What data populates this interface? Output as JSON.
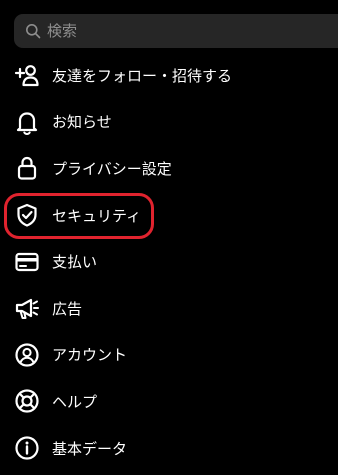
{
  "search": {
    "placeholder": "検索",
    "icon": "search-icon"
  },
  "menu": {
    "items": [
      {
        "icon": "add-user-icon",
        "label": "友達をフォロー・招待する"
      },
      {
        "icon": "bell-icon",
        "label": "お知らせ"
      },
      {
        "icon": "lock-icon",
        "label": "プライバシー設定"
      },
      {
        "icon": "shield-check-icon",
        "label": "セキュリティ"
      },
      {
        "icon": "credit-card-icon",
        "label": "支払い"
      },
      {
        "icon": "megaphone-icon",
        "label": "広告"
      },
      {
        "icon": "user-circle-icon",
        "label": "アカウント"
      },
      {
        "icon": "lifebuoy-icon",
        "label": "ヘルプ"
      },
      {
        "icon": "info-icon",
        "label": "基本データ"
      }
    ]
  },
  "colors": {
    "background": "#000000",
    "search_background": "#262626",
    "placeholder": "#8e8e8e",
    "text": "#ffffff",
    "highlight": "#e0232e"
  }
}
